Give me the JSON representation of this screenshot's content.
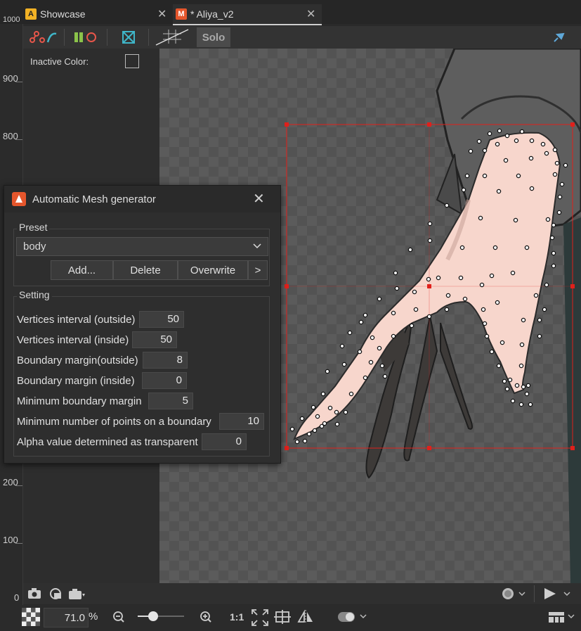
{
  "tabs": [
    {
      "label": "Showcase",
      "icon_letter": "A",
      "icon_color": "#f2b225",
      "active": false
    },
    {
      "label": "* Aliya_v2",
      "icon_letter": "M",
      "icon_color": "#e5562c",
      "active": true
    }
  ],
  "ruler": {
    "labels": [
      "1000",
      "900",
      "800",
      "200",
      "100",
      "0"
    ]
  },
  "toolbar": {
    "solo_label": "Solo"
  },
  "left_panel": {
    "inactive_color_label": "Inactive Color:"
  },
  "dialog": {
    "title": "Automatic Mesh generator",
    "close_glyph": "✕",
    "preset_group_label": "Preset",
    "preset_value": "body",
    "buttons": {
      "add": "Add...",
      "delete": "Delete",
      "overwrite": "Overwrite",
      "more": ">"
    },
    "setting_group_label": "Setting",
    "settings": [
      {
        "label": "Vertices interval (outside)",
        "value": "50"
      },
      {
        "label": "Vertices interval (inside)",
        "value": "50"
      },
      {
        "label": "Boundary margin(outside)",
        "value": "8"
      },
      {
        "label": "Boundary margin (inside)",
        "value": "0"
      },
      {
        "label": "Minimum boundary margin",
        "value": "5"
      },
      {
        "label": "Minimum number of points on a boundary",
        "value": "10"
      },
      {
        "label": "Alpha value determined as transparent",
        "value": "0"
      }
    ]
  },
  "bottom": {
    "zoom_value": "71.0",
    "zoom_unit": "%",
    "one_to_one": "1:1",
    "zoom_slider_fraction": 0.33
  },
  "colors": {
    "accent": "#e5562c",
    "selection": "#e0201b",
    "skin": "#f7d6cc",
    "mesh_point": "#ffffff"
  },
  "icons": [
    "mesh-edit-icon",
    "deformer-icon",
    "glue-icon",
    "grid-icon",
    "pin-icon",
    "camera-icon",
    "refresh-view-icon",
    "camera-export-icon",
    "play-icon",
    "zoom-out-icon",
    "zoom-in-icon",
    "fit-icon",
    "guide-icon",
    "flip-icon",
    "toggle-icon",
    "layout-icon",
    "checker-icon"
  ]
}
